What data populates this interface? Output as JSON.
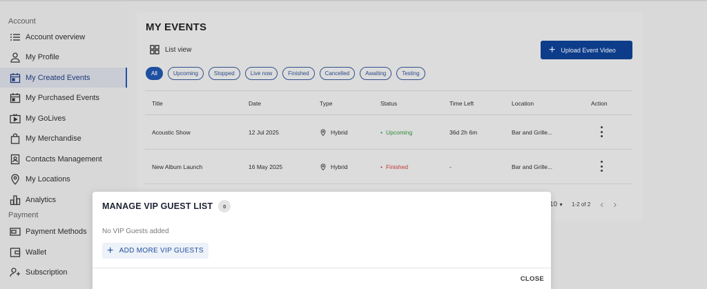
{
  "sidebar": {
    "account_section": "Account",
    "payment_section": "Payment",
    "items": [
      {
        "label": "Account overview",
        "icon": "list-icon"
      },
      {
        "label": "My Profile",
        "icon": "person-icon"
      },
      {
        "label": "My Created Events",
        "icon": "calendar-icon",
        "active": true
      },
      {
        "label": "My Purchased Events",
        "icon": "calendar-icon"
      },
      {
        "label": "My GoLives",
        "icon": "tv-play-icon"
      },
      {
        "label": "My Merchandise",
        "icon": "shopping-bag-icon"
      },
      {
        "label": "Contacts Management",
        "icon": "contact-card-icon"
      },
      {
        "label": "My Locations",
        "icon": "location-pin-icon"
      },
      {
        "label": "Analytics",
        "icon": "bar-chart-icon"
      }
    ],
    "payment_items": [
      {
        "label": "Payment Methods",
        "icon": "payment-card-icon"
      },
      {
        "label": "Wallet",
        "icon": "wallet-icon"
      },
      {
        "label": "Subscription",
        "icon": "subscription-icon"
      }
    ]
  },
  "main": {
    "title": "MY EVENTS",
    "list_view_label": "List view",
    "upload_label": "Upload Event Video",
    "filters": [
      "All",
      "Upcoming",
      "Stopped",
      "Live now",
      "Finished",
      "Cancelled",
      "Awaiting",
      "Testing"
    ],
    "columns": [
      "Title",
      "Date",
      "Type",
      "Status",
      "Time Left",
      "Location",
      "Action"
    ],
    "rows": [
      {
        "title": "Acoustic Show",
        "date": "12 Jul 2025",
        "type": "Hybrid",
        "status": "Upcoming",
        "time_left": "36d 2h 6m",
        "location": "Bar and Grille..."
      },
      {
        "title": "New Album Launch",
        "date": "16 May 2025",
        "type": "Hybrid",
        "status": "Finished",
        "time_left": "-",
        "location": "Bar and Grille..."
      }
    ],
    "pagination": {
      "per_page": "10",
      "range": "1-2 of 2"
    }
  },
  "dialog": {
    "title": "MANAGE VIP GUEST LIST",
    "count": "0",
    "empty_text": "No VIP Guests added",
    "add_label": "ADD MORE VIP GUESTS",
    "close_label": "CLOSE"
  },
  "colors": {
    "accent": "#1f4fa0",
    "upload_button": "#0d3d8a",
    "status_upcoming": "#2e8b3a",
    "status_finished": "#c0393b"
  }
}
